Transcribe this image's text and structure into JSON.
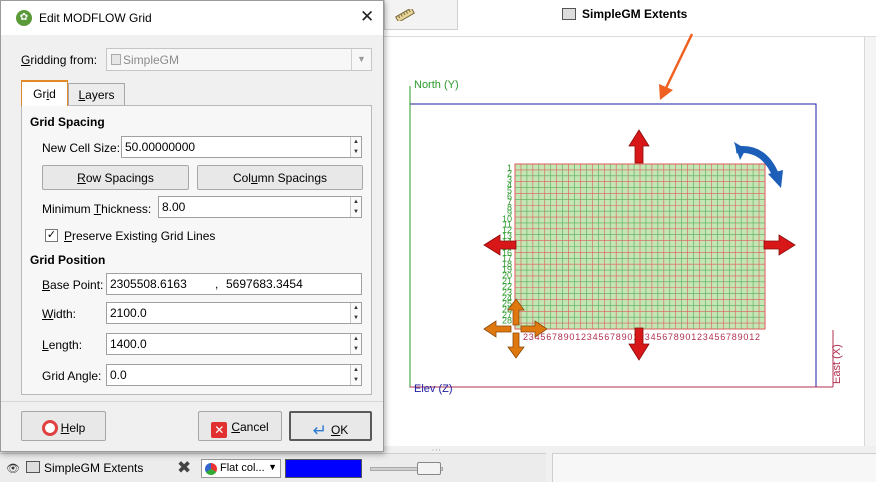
{
  "dialog": {
    "title": "Edit MODFLOW Grid",
    "gridding_from_label": "Gridding from:",
    "gridding_from_value": "SimpleGM",
    "tabs": [
      {
        "label": "Grid",
        "active": true
      },
      {
        "label": "Layers",
        "active": false
      }
    ],
    "grid_spacing": {
      "heading": "Grid Spacing",
      "new_cell_size_label": "New Cell Size:",
      "new_cell_size_value": "50.00000000",
      "row_spacings_label": "Row Spacings",
      "column_spacings_label": "Column Spacings",
      "min_thickness_label": "Minimum Thickness:",
      "min_thickness_value": "8.00",
      "preserve_label": "Preserve Existing Grid Lines",
      "preserve_checked": true
    },
    "grid_position": {
      "heading": "Grid Position",
      "base_point_label": "Base Point:",
      "base_point_x": "2305508.6163",
      "base_point_sep": ",",
      "base_point_y": "5697683.3454",
      "width_label": "Width:",
      "width_value": "2100.0",
      "length_label": "Length:",
      "length_value": "1400.0",
      "grid_angle_label": "Grid Angle:",
      "grid_angle_value": "0.0"
    },
    "buttons": {
      "help": "Help",
      "cancel": "Cancel",
      "ok": "OK"
    }
  },
  "scene": {
    "north_label": "North (Y)",
    "east_label": "East (X)",
    "elev_label": "Elev (Z)",
    "row_numbers": [
      "1",
      "2",
      "3",
      "4",
      "5",
      "6",
      "7",
      "8",
      "9",
      "10",
      "11",
      "12",
      "13",
      "14",
      "15",
      "16",
      "17",
      "18",
      "19",
      "20",
      "21",
      "22",
      "23",
      "24",
      "25",
      "26",
      "27",
      "28"
    ],
    "column_numbers": [
      "2",
      "3",
      "4",
      "5",
      "6",
      "7",
      "8",
      "9",
      "0",
      "1",
      "2",
      "3",
      "4",
      "5",
      "6",
      "7",
      "8",
      "9",
      "0",
      "1",
      "2",
      "3",
      "4",
      "5",
      "6",
      "7",
      "8",
      "9",
      "0",
      "1",
      "2",
      "3",
      "4",
      "5",
      "6",
      "7",
      "8",
      "9",
      "0",
      "1",
      "2"
    ],
    "colors": {
      "frame": "#1c1ca0",
      "north_axis": "#2a9a2a",
      "east_axis": "#b03050",
      "grid_fill": "#c4e6b4",
      "grid_line_red": "#e05a5a",
      "grid_line_green": "#59a859",
      "arrow_red": "#d81818",
      "arrow_orange": "#e07810",
      "arrow_blue": "#1d5fb8",
      "pointer": "#f06020"
    }
  },
  "shapes_bar": {
    "object_label": "SimpleGM Extents",
    "colour_mode": "Flat col...",
    "colour_value": "#0000ff"
  },
  "properties_panel": {
    "title": "SimpleGM Extents"
  }
}
